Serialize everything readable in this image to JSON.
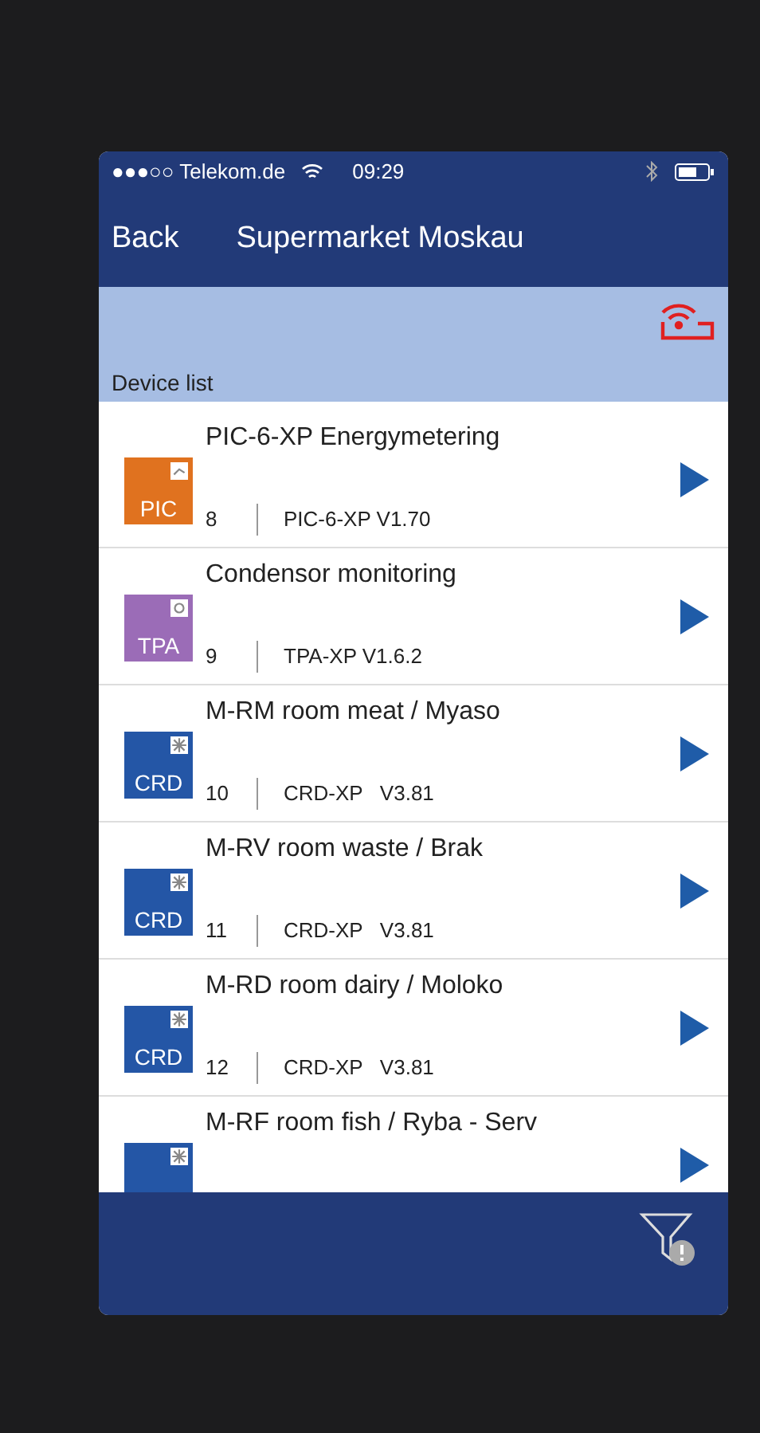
{
  "status_bar": {
    "carrier": "●●●○○ Telekom.de",
    "time": "09:29"
  },
  "nav_bar": {
    "back": "Back",
    "title": "Supermarket Moskau"
  },
  "section": {
    "label": "Device list"
  },
  "devices": [
    {
      "badge": "PIC",
      "color": "#e0721f",
      "kind": "meter",
      "title": "PIC-6-XP Energymetering",
      "number": "8",
      "model": "PIC-6-XP V1.70"
    },
    {
      "badge": "TPA",
      "color": "#9b6cb7",
      "kind": "fan",
      "title": "Condensor monitoring",
      "number": "9",
      "model": "TPA-XP V1.6.2"
    },
    {
      "badge": "CRD",
      "color": "#2456a6",
      "kind": "snow",
      "title": "M-RM room meat / Myaso",
      "number": "10",
      "model": "CRD-XP   V3.81"
    },
    {
      "badge": "CRD",
      "color": "#2456a6",
      "kind": "snow",
      "title": "M-RV room waste / Brak",
      "number": "11",
      "model": "CRD-XP   V3.81"
    },
    {
      "badge": "CRD",
      "color": "#2456a6",
      "kind": "snow",
      "title": "M-RD room dairy / Moloko",
      "number": "12",
      "model": "CRD-XP   V3.81"
    },
    {
      "color": "#2456a6",
      "kind": "snow",
      "title": "M-RF room fish / Ryba - Serv"
    }
  ]
}
